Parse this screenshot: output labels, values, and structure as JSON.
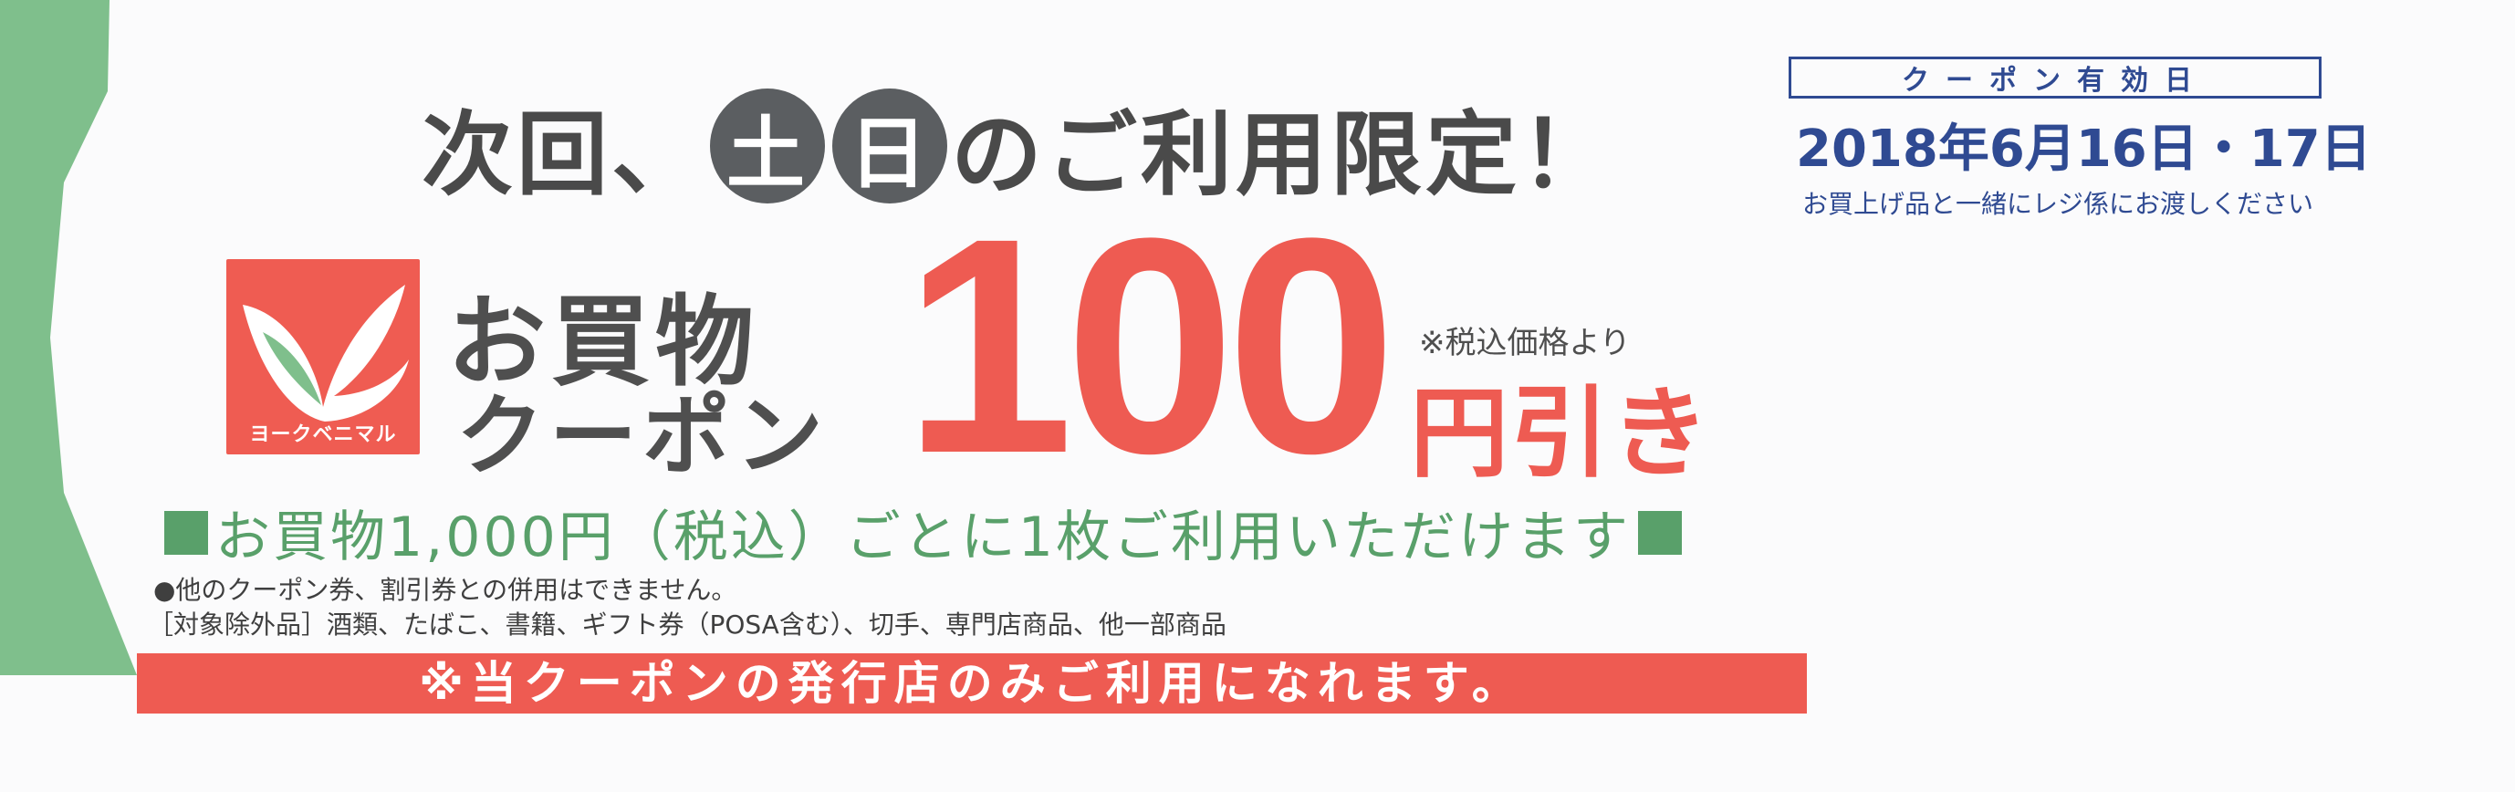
{
  "colors": {
    "green": "#59a06a",
    "red": "#ee5b52",
    "gray": "#4f4f4f",
    "navy": "#2f4a92"
  },
  "headline": {
    "prefix": "次回、",
    "day1": "土",
    "day2": "日",
    "suffix": "のご利用限定！"
  },
  "logo": {
    "name": "ヨークベニマル"
  },
  "brand": {
    "line1": "お買物",
    "line2": "クーポン"
  },
  "offer": {
    "amount": "100",
    "tax_note": "※税込価格より",
    "discount": "円引き"
  },
  "condition": "お買物1,000円（税込）ごとに1枚ご利用いただけます",
  "notes": {
    "line1": "●他のクーポン券、割引券との併用はできません。",
    "line2": "［対象除外品］酒類、たばこ、書籍、ギフト券（POSA含む）、切手、専門店商品、他一部商品"
  },
  "bottom_bar": "※当クーポンの発行店のみご利用になれます。",
  "validity": {
    "label": "クーポン有効日",
    "date": "2018年6月16日・17日",
    "note": "お買上げ品と一緒にレジ係にお渡しください"
  }
}
